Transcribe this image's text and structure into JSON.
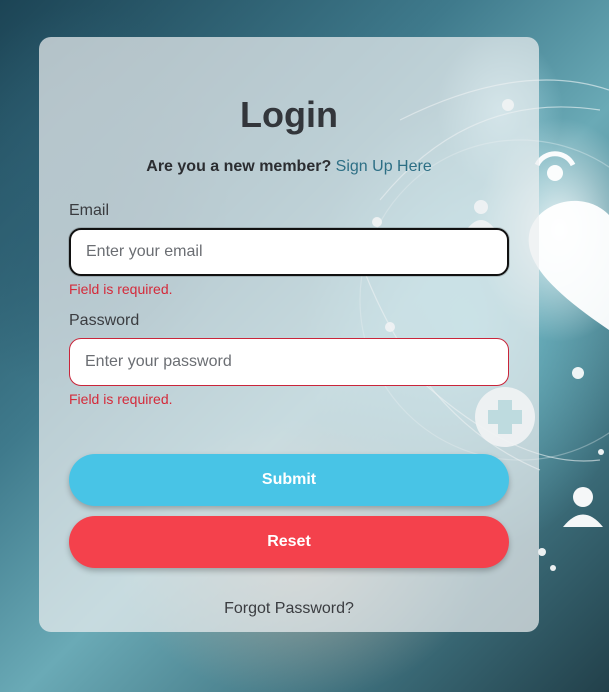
{
  "login": {
    "title": "Login",
    "signup_question": "Are you a new member?",
    "signup_link": "Sign Up Here",
    "email": {
      "label": "Email",
      "placeholder": "Enter your email",
      "value": "",
      "error": "Field is required."
    },
    "password": {
      "label": "Password",
      "placeholder": "Enter your password",
      "value": "",
      "error": "Field is required."
    },
    "submit_label": "Submit",
    "reset_label": "Reset",
    "forgot_label": "Forgot Password?"
  },
  "colors": {
    "submit": "#48c4e6",
    "reset": "#f4414c",
    "error": "#d42a3a",
    "link": "#2d6f85"
  },
  "background": {
    "icons": [
      "plus-icon",
      "person-icon",
      "person-icon",
      "signal-icon",
      "heart-icon"
    ]
  }
}
